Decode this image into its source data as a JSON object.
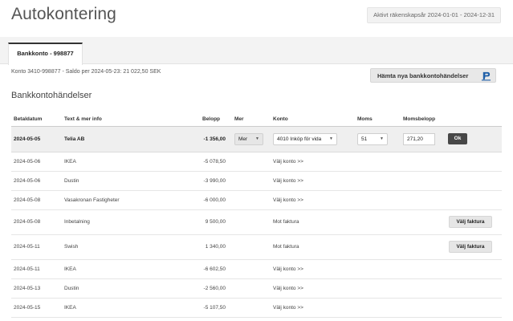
{
  "header": {
    "title": "Autokontering",
    "fiscal_year": "Aktivt räkenskapsår 2024-01-01 - 2024-12-31"
  },
  "tabs": [
    {
      "label": "Bankkonto - 998877",
      "active": true
    }
  ],
  "account_info": "Konto 3410-998877 - Saldo per 2024-05-23: 21 022,50 SEK",
  "fetch_button": {
    "label": "Hämta nya bankkontohändelser",
    "icon": "bank-logo-icon"
  },
  "section_title": "Bankkontohändelser",
  "table": {
    "columns": {
      "date": "Betaldatum",
      "text": "Text & mer info",
      "amount": "Belopp",
      "more": "Mer",
      "account": "Konto",
      "vat": "Moms",
      "vat_amount": "Momsbelopp"
    },
    "active_row": {
      "date": "2024-05-05",
      "text": "Telia AB",
      "amount": "-1 356,00",
      "more": "Mer",
      "account": "4010 Inköp för vida",
      "vat": "51",
      "vat_amount": "271,20",
      "ok": "Ok"
    },
    "rows": [
      {
        "date": "2024-05-06",
        "text": "IKEA",
        "amount": "-5 078,50",
        "account": "Välj konto >>"
      },
      {
        "date": "2024-05-06",
        "text": "Dustin",
        "amount": "-3 990,00",
        "account": "Välj konto >>"
      },
      {
        "date": "2024-05-08",
        "text": "Vasakronan Fastigheter",
        "amount": "-6 000,00",
        "account": "Välj konto >>"
      },
      {
        "date": "2024-05-08",
        "text": "Inbetalning",
        "amount": "9 500,00",
        "account": "Mot faktura",
        "action": "Välj faktura"
      },
      {
        "date": "2024-05-11",
        "text": "Swish",
        "amount": "1 340,00",
        "account": "Mot faktura",
        "action": "Välj faktura"
      },
      {
        "date": "2024-05-11",
        "text": "IKEA",
        "amount": "-6 602,50",
        "account": "Välj konto >>"
      },
      {
        "date": "2024-05-13",
        "text": "Dustin",
        "amount": "-2 560,00",
        "account": "Välj konto >>"
      },
      {
        "date": "2024-05-15",
        "text": "IKEA",
        "amount": "-5 107,50",
        "account": "Välj konto >>"
      }
    ]
  },
  "icons": {
    "dropdown": "chevron-down-icon"
  }
}
